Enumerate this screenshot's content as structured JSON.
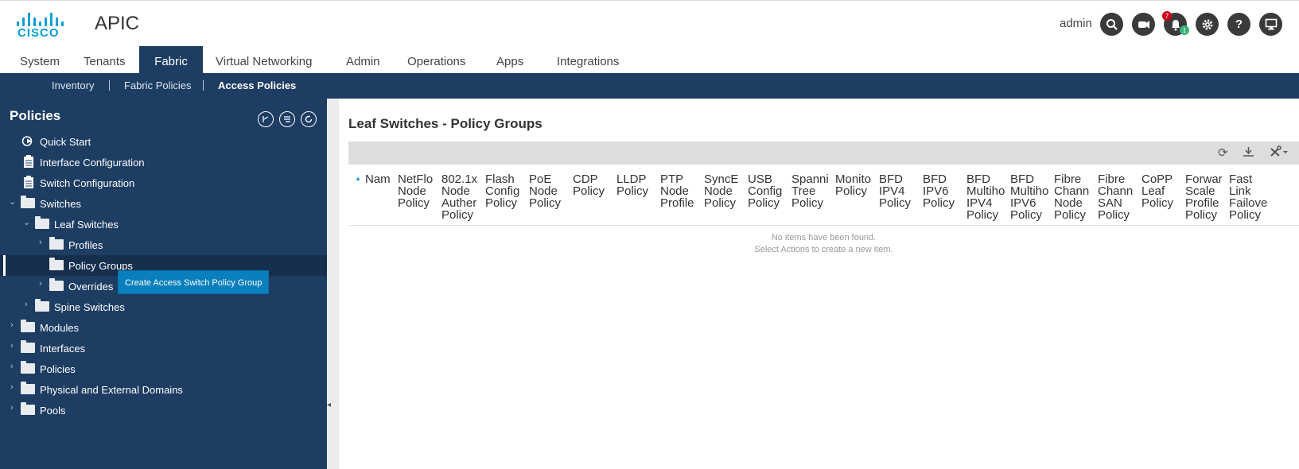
{
  "header": {
    "logo_text": "CISCO",
    "app_title": "APIC",
    "user": "admin",
    "alert_count_red": "7",
    "alert_count_green": "1"
  },
  "main_nav": [
    "System",
    "Tenants",
    "Fabric",
    "Virtual Networking",
    "Admin",
    "Operations",
    "Apps",
    "Integrations"
  ],
  "sub_nav": [
    "Inventory",
    "Fabric Policies",
    "Access Policies"
  ],
  "sidebar": {
    "title": "Policies",
    "items": [
      "Quick Start",
      "Interface Configuration",
      "Switch Configuration",
      "Switches",
      "Leaf Switches",
      "Profiles",
      "Policy Groups",
      "Overrides",
      "Spine Switches",
      "Modules",
      "Interfaces",
      "Policies",
      "Physical and External Domains",
      "Pools"
    ]
  },
  "tooltip": "Create Access Switch Policy Group",
  "content": {
    "title": "Leaf Switches - Policy Groups",
    "columns": [
      "Nam",
      "NetFlo\nNode\nPolicy",
      "802.1x\nNode\nAuther\nPolicy",
      "Flash\nConfig\nPolicy",
      "PoE\nNode\nPolicy",
      "CDP\nPolicy",
      "LLDP\nPolicy",
      "PTP\nNode\nProfile",
      "SyncE\nNode\nPolicy",
      "USB\nConfig\nPolicy",
      "Spanni\nTree\nPolicy",
      "Monito\nPolicy",
      "BFD\nIPV4\nPolicy",
      "BFD\nIPV6\nPolicy",
      "BFD\nMultiho\nIPV4\nPolicy",
      "BFD\nMultiho\nIPV6\nPolicy",
      "Fibre\nChann\nNode\nPolicy",
      "Fibre\nChann\nSAN\nPolicy",
      "CoPP\nLeaf\nPolicy",
      "Forwar\nScale\nProfile\nPolicy",
      "Fast\nLink\nFailove\nPolicy"
    ],
    "empty_line1": "No items have been found.",
    "empty_line2": "Select Actions to create a new item."
  }
}
